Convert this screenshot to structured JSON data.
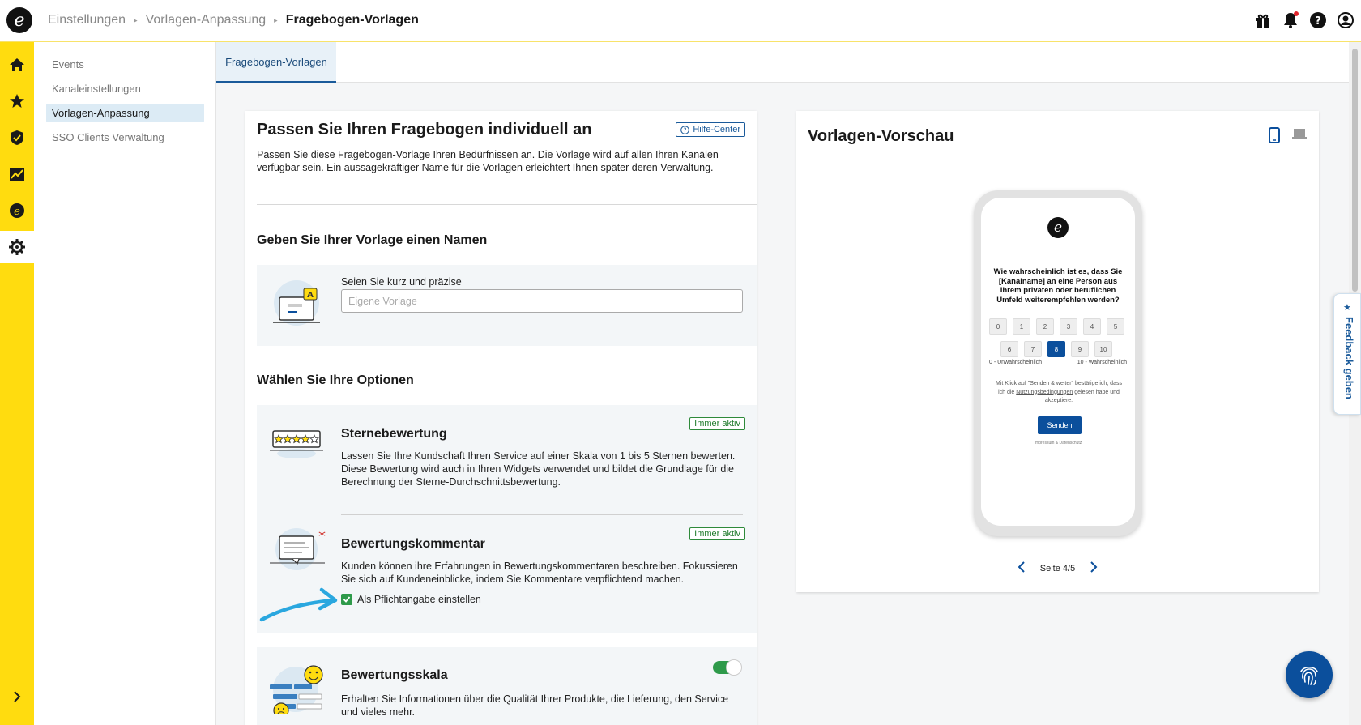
{
  "breadcrumb": [
    "Einstellungen",
    "Vorlagen-Anpassung",
    "Fragebogen-Vorlagen"
  ],
  "top_icons": [
    "gift-icon",
    "bell-icon",
    "help-icon",
    "account-icon"
  ],
  "rail": {
    "items": [
      "home-icon",
      "star-icon",
      "shield-icon",
      "chart-icon",
      "trusted-icon",
      "settings-icon"
    ],
    "active": "settings-icon"
  },
  "subnav": {
    "items": [
      {
        "label": "Events",
        "active": false
      },
      {
        "label": "Kanaleinstellungen",
        "active": false
      },
      {
        "label": "Vorlagen-Anpassung",
        "active": true
      },
      {
        "label": "SSO Clients Verwaltung",
        "active": false
      }
    ]
  },
  "tabs": [
    {
      "label": "Fragebogen-Vorlagen",
      "active": true
    }
  ],
  "customize": {
    "title": "Passen Sie Ihren Fragebogen individuell an",
    "help_label": "Hilfe-Center",
    "intro": "Passen Sie diese Fragebogen-Vorlage Ihren Bedürfnissen an. Die Vorlage wird auf allen Ihren Kanälen verfügbar sein. Ein aussagekräftiger Name für die Vorlagen erleichtert Ihnen später deren Verwaltung.",
    "name_section": {
      "heading": "Geben Sie Ihrer Vorlage einen Namen",
      "field_label": "Seien Sie kurz und präzise",
      "placeholder": "Eigene Vorlage",
      "value": ""
    },
    "options_heading": "Wählen Sie Ihre Optionen",
    "options": {
      "stars": {
        "title": "Sternebewertung",
        "badge": "Immer aktiv",
        "desc": "Lassen Sie Ihre Kundschaft Ihren Service auf einer Skala von 1 bis 5 Sternen bewerten. Diese Bewertung wird auch in Ihren Widgets verwendet und bildet die Grundlage für die Berechnung der Sterne-Durchschnittsbewertung."
      },
      "comment": {
        "title": "Bewertungskommentar",
        "badge": "Immer aktiv",
        "desc": "Kunden können ihre Erfahrungen in Bewertungskommentaren beschreiben. Fokussieren Sie sich auf Kundeneinblicke, indem Sie Kommentare verpflichtend machen.",
        "checkbox_label": "Als Pflichtangabe einstellen",
        "checked": true
      },
      "scale": {
        "title": "Bewertungsskala",
        "enabled": true,
        "desc": "Erhalten Sie Informationen über die Qualität Ihrer Produkte, die Lieferung, den Service und vieles mehr."
      }
    }
  },
  "preview": {
    "title": "Vorlagen-Vorschau",
    "device_icons": [
      "mobile-icon",
      "laptop-icon"
    ],
    "active_device": "mobile-icon",
    "question": "Wie wahrscheinlich ist es, dass Sie [Kanalname] an eine Person aus Ihrem privaten oder beruflichen Umfeld weiterempfehlen werden?",
    "nps_row1": [
      "0",
      "1",
      "2",
      "3",
      "4",
      "5"
    ],
    "nps_row2": [
      "6",
      "7",
      "8",
      "9",
      "10"
    ],
    "nps_selected": "8",
    "scale_low": "0 - Unwahrscheinlich",
    "scale_high": "10 - Wahrscheinlich",
    "consent_pre": "Mit Klick auf \"Senden & weiter\" bestätige ich, dass ich die",
    "consent_link": "Nutzungsbedingungen",
    "consent_post": "gelesen habe und akzeptiere.",
    "send_label": "Senden",
    "footer": "Impressum & Datenschutz",
    "page_label": "Seite 4/5"
  },
  "feedback_label": "Feedback geben",
  "colors": {
    "brand_yellow": "#ffdc0f",
    "primary_blue": "#0b4f9c",
    "success_green": "#2e9a4a"
  }
}
